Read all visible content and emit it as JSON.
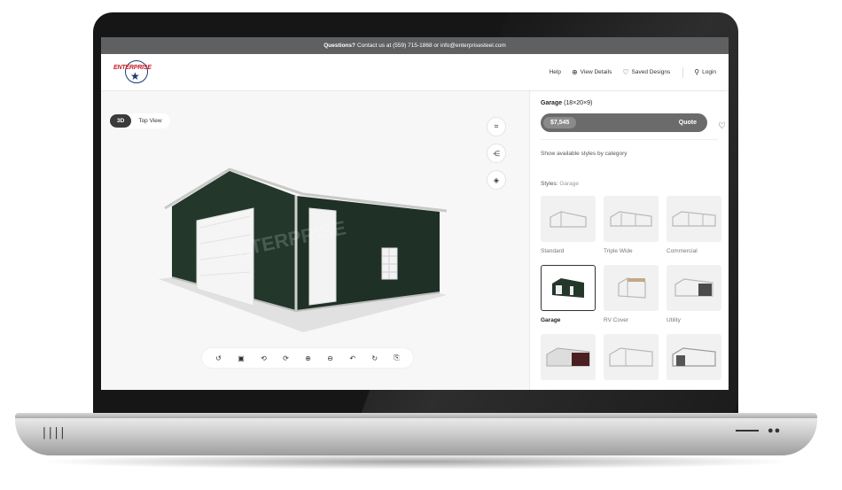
{
  "topbar": {
    "lead": "Questions?",
    "rest": "Contact us at (559) 715-1868 or info@enterprisesteel.com"
  },
  "header": {
    "logo_text": "ENTERPRISE",
    "nav": [
      {
        "label": "Help",
        "icon": ""
      },
      {
        "label": "View Details",
        "icon": "zoom-plus-icon"
      },
      {
        "label": "Saved Designs",
        "icon": "heart-icon"
      },
      {
        "label": "Login",
        "icon": "user-icon"
      }
    ]
  },
  "viewer": {
    "view_toggle": {
      "active": "3D",
      "inactive": "Top View"
    },
    "watermark": "ENTERPRISE",
    "side_tools": [
      "screenshot-icon",
      "share-icon",
      "ar-icon"
    ],
    "toolbar": [
      "reset-icon",
      "image-icon",
      "rotate-left-icon",
      "rotate-right-icon",
      "zoom-in-icon",
      "zoom-out-icon",
      "undo-icon",
      "redo-icon",
      "export-icon"
    ]
  },
  "panel": {
    "title_bold": "Garage",
    "title_dims": "(18×20×9)",
    "price": "$7,545",
    "quote_label": "Quote",
    "show_styles": "Show available styles by category",
    "styles_prefix": "Styles:",
    "styles_value": "Garage",
    "cards": [
      {
        "label": "Standard",
        "selected": false
      },
      {
        "label": "Triple Wide",
        "selected": false
      },
      {
        "label": "Commercial",
        "selected": false
      },
      {
        "label": "Garage",
        "selected": true
      },
      {
        "label": "RV Cover",
        "selected": false
      },
      {
        "label": "Utility",
        "selected": false
      },
      {
        "label": "",
        "selected": false
      },
      {
        "label": "",
        "selected": false
      },
      {
        "label": "",
        "selected": false
      }
    ]
  },
  "colors": {
    "topbar": "#5f6062",
    "building_wall": "#23372a",
    "price_bar": "#6b6b6b"
  }
}
